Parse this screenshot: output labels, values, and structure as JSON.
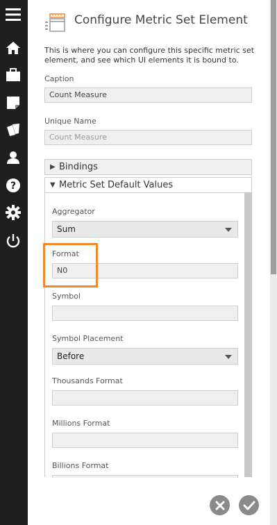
{
  "sidebar": {
    "items": [
      {
        "icon": "menu-icon"
      },
      {
        "icon": "home-icon"
      },
      {
        "icon": "briefcase-icon"
      },
      {
        "icon": "note-icon"
      },
      {
        "icon": "cards-icon"
      },
      {
        "icon": "user-icon"
      },
      {
        "icon": "help-icon"
      },
      {
        "icon": "gear-icon"
      },
      {
        "icon": "power-icon"
      }
    ],
    "background": "#1f1f1f",
    "icon_color": "#ffffff"
  },
  "header": {
    "icon": "metric-set-element-icon",
    "title": "Configure Metric Set Element"
  },
  "description": "This is where you can configure this specific metric set element, and see which UI elements it is bound to.",
  "form": {
    "caption": {
      "label": "Caption",
      "value": "Count Measure"
    },
    "unique_name": {
      "label": "Unique Name",
      "placeholder": "Count Measure"
    }
  },
  "sections": {
    "bindings": {
      "label": "Bindings",
      "expanded": false
    },
    "defaults": {
      "label": "Metric Set Default Values",
      "expanded": true
    }
  },
  "defaults": {
    "aggregator": {
      "label": "Aggregator",
      "value": "Sum"
    },
    "format": {
      "label": "Format",
      "value": "N0",
      "highlight_color": "#f0892d"
    },
    "symbol": {
      "label": "Symbol",
      "value": ""
    },
    "symbol_placement": {
      "label": "Symbol Placement",
      "value": "Before"
    },
    "thousands_format": {
      "label": "Thousands Format",
      "value": ""
    },
    "millions_format": {
      "label": "Millions Format",
      "value": ""
    },
    "billions_format": {
      "label": "Billions Format",
      "value": ""
    }
  },
  "footer": {
    "cancel_icon": "close-icon",
    "confirm_icon": "check-icon"
  }
}
